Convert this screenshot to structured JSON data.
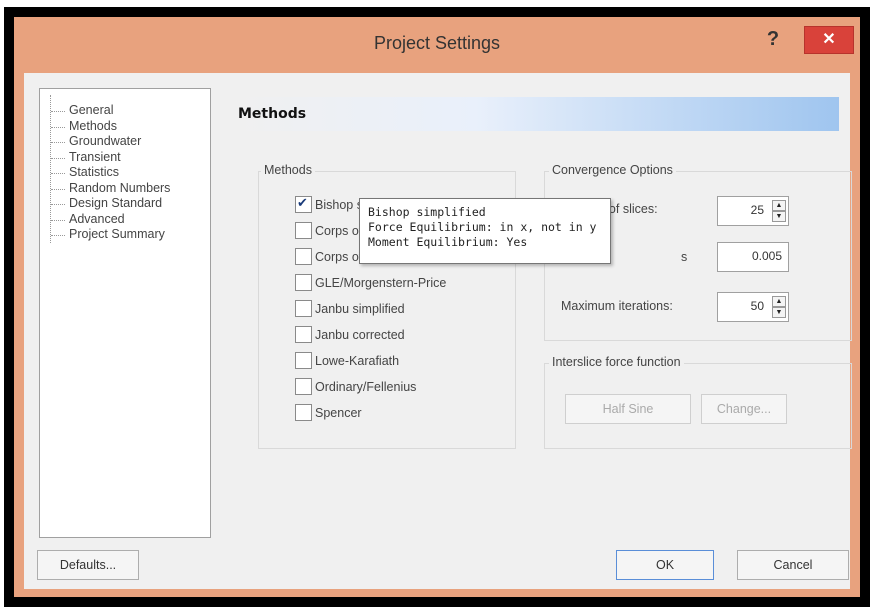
{
  "window": {
    "title": "Project Settings",
    "help": "?",
    "close": "✕"
  },
  "nav": {
    "items": [
      "General",
      "Methods",
      "Groundwater",
      "Transient",
      "Statistics",
      "Random Numbers",
      "Design Standard",
      "Advanced",
      "Project Summary"
    ]
  },
  "panel": {
    "header": "Methods"
  },
  "methods": {
    "group_label": "Methods",
    "items": [
      {
        "label": "Bishop simplified",
        "checked": true
      },
      {
        "label": "Corps of E",
        "checked": false
      },
      {
        "label": "Corps of E",
        "checked": false
      },
      {
        "label": "GLE/Morgenstern-Price",
        "checked": false
      },
      {
        "label": "Janbu simplified",
        "checked": false
      },
      {
        "label": "Janbu corrected",
        "checked": false
      },
      {
        "label": "Lowe-Karafiath",
        "checked": false
      },
      {
        "label": "Ordinary/Fellenius",
        "checked": false
      },
      {
        "label": "Spencer",
        "checked": false
      }
    ]
  },
  "convergence": {
    "group_label": "Convergence Options",
    "slices_label": "Number of slices:",
    "slices_value": "25",
    "tolerance_label": "s",
    "tolerance_value": "0.005",
    "iterations_label": "Maximum iterations:",
    "iterations_value": "50"
  },
  "interslice": {
    "group_label": "Interslice force function",
    "function_value": "Half Sine",
    "change_label": "Change..."
  },
  "tooltip": {
    "line1": "Bishop simplified",
    "line2": "Force Equilibrium: in x, not in y",
    "line3": "Moment Equilibrium: Yes"
  },
  "buttons": {
    "defaults": "Defaults...",
    "ok": "OK",
    "cancel": "Cancel"
  },
  "icons": {
    "spin_up": "▲",
    "spin_down": "▼"
  }
}
